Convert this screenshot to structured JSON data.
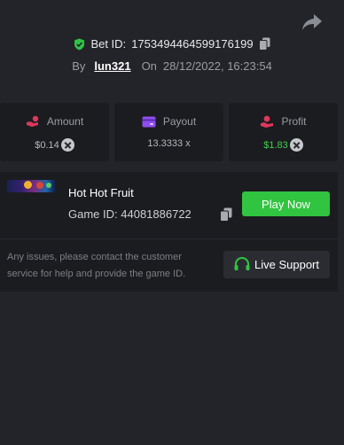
{
  "bet": {
    "id_label": "Bet ID:",
    "id_value": "1753494464599176199",
    "by_label": "By",
    "user": "lun321",
    "on_label": "On",
    "datetime": "28/12/2022, 16:23:54"
  },
  "stats": [
    {
      "label": "Amount",
      "value": "$0.14"
    },
    {
      "label": "Payout",
      "value": "13.3333 x"
    },
    {
      "label": "Profit",
      "value": "$1.83"
    }
  ],
  "game": {
    "name": "Hot Hot Fruit",
    "id_label": "Game ID:",
    "id_value": "44081886722",
    "play_label": "Play Now",
    "note": "Any issues, please contact the customer service for help and provide the game ID.",
    "support_label": "Live Support"
  },
  "colors": {
    "background": "#232429",
    "panel": "#1b1c20",
    "accent_green": "#31c440",
    "profit_green": "#3fd14a",
    "amount_icon": "#e0375c",
    "payout_icon": "#8f4ef0",
    "profit_icon": "#e0375c"
  },
  "icons": {
    "share": "share-arrow-icon",
    "shield": "shield-check-icon",
    "copy": "copy-icon",
    "amount": "hand-coin-icon",
    "payout": "wallet-card-icon",
    "profit": "hand-profit-icon",
    "currency": "currency-coin-icon",
    "support": "headset-icon"
  }
}
